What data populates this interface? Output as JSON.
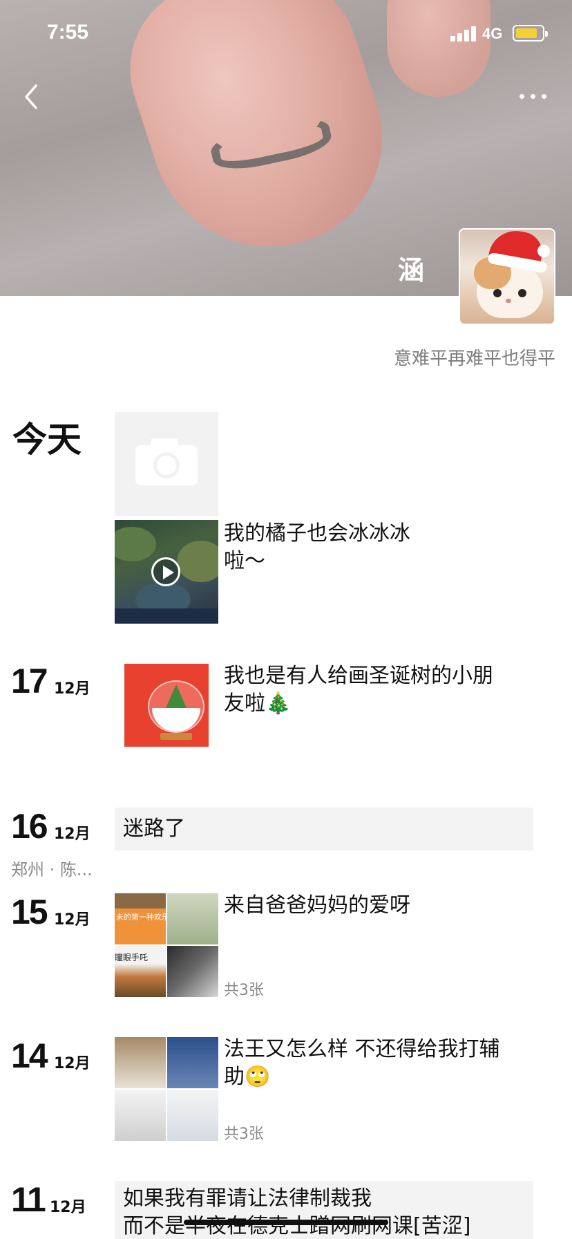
{
  "status_bar": {
    "time": "7:55",
    "network": "4G"
  },
  "profile": {
    "name": "涵",
    "signature": "意难平再难平也得平"
  },
  "timeline": [
    {
      "date_label": "今天",
      "posts": [
        {
          "kind": "camera-placeholder"
        },
        {
          "kind": "video",
          "caption_lines": [
            "我的橘子也会冰冰冰",
            "啦～"
          ]
        }
      ]
    },
    {
      "day": "17",
      "month": "12月",
      "caption_lines": [
        "我也是有人给画圣诞树的小朋",
        "友啦🎄"
      ]
    },
    {
      "day": "16",
      "month": "12月",
      "text": "迷路了",
      "location": "郑州 · 陈..."
    },
    {
      "day": "15",
      "month": "12月",
      "caption_lines": [
        "来自爸爸妈妈的爱呀"
      ],
      "thumb_text": [
        "未的第一种欢乐",
        "瞳眼手吒"
      ],
      "count": "共3张"
    },
    {
      "day": "14",
      "month": "12月",
      "caption_lines": [
        "法王又怎么样 不还得给我打辅",
        "助🙄"
      ],
      "count": "共3张"
    },
    {
      "day": "11",
      "month": "12月",
      "text_lines": [
        "如果我有罪请让法律制裁我",
        "而不是半夜在德克士蹭网刷网课[苦涩]"
      ]
    }
  ],
  "icons": {
    "back": "chevron-left-icon",
    "more": "more-dots-icon",
    "camera": "camera-icon",
    "play": "play-icon"
  },
  "colors": {
    "accent_battery": "#f4cf38",
    "text_post_bg": "#f3f3f3",
    "meta_gray": "#8a8a8a"
  }
}
